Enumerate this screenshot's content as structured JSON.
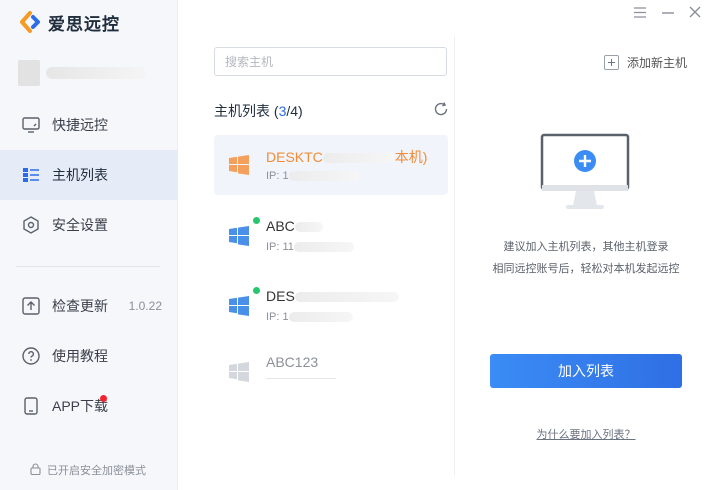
{
  "app": {
    "name": "爱思远控"
  },
  "colors": {
    "accent": "#2b6ce8",
    "active_host": "#f08c3a",
    "online": "#28c76f",
    "badge": "#f5222d"
  },
  "sidebar": {
    "items": [
      {
        "label": "快捷远控",
        "icon": "monitor-icon"
      },
      {
        "label": "主机列表",
        "icon": "list-icon",
        "active": true
      },
      {
        "label": "安全设置",
        "icon": "shield-icon"
      },
      {
        "label": "检查更新",
        "icon": "upload-icon",
        "version": "1.0.22"
      },
      {
        "label": "使用教程",
        "icon": "help-icon"
      },
      {
        "label": "APP下载",
        "icon": "phone-icon",
        "badge": true
      }
    ],
    "secure_mode": "已开启安全加密模式"
  },
  "search": {
    "placeholder": "搜索主机"
  },
  "host_list": {
    "title_prefix": "主机列表 (",
    "current": "3",
    "total": "/4",
    "title_suffix": ")",
    "hosts": [
      {
        "name_start": "DESKTC",
        "name_end": "本机)",
        "ip_label": "IP: 1",
        "status": "current"
      },
      {
        "name_start": "ABC",
        "ip_label": "IP: 11",
        "status": "online"
      },
      {
        "name_start": "DES",
        "ip_label": "IP: 1",
        "status": "online"
      },
      {
        "name_start": "ABC123",
        "status": "offline"
      }
    ]
  },
  "actions": {
    "add_new_host": "添加新主机",
    "hint_line1": "建议加入主机列表，其他主机登录",
    "hint_line2": "相同远控账号后，轻松对本机发起远控",
    "add_to_list": "加入列表",
    "why_link": "为什么要加入列表？"
  }
}
